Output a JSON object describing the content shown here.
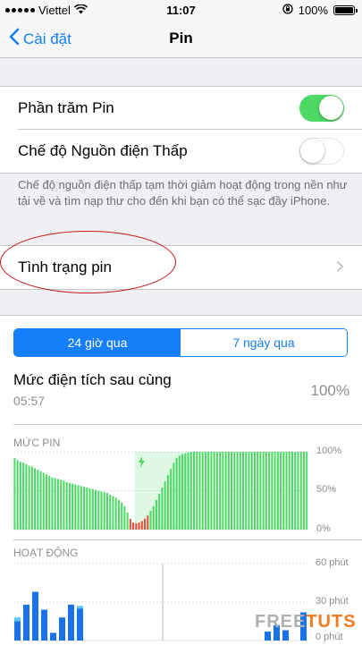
{
  "status_bar": {
    "carrier": "Viettel",
    "time": "11:07",
    "battery": "100%"
  },
  "nav": {
    "back_label": "Cài đặt",
    "title": "Pin"
  },
  "settings": {
    "battery_percentage": {
      "label": "Phần trăm Pin",
      "on": true
    },
    "low_power_mode": {
      "label": "Chế độ Nguồn điện Thấp",
      "on": false
    },
    "footnote": "Chế độ nguồn điện thấp tạm thời giảm hoạt động trong nền như tải về và tìm nạp thư cho đến khi bạn có thể sạc đầy iPhone.",
    "battery_health": {
      "label": "Tình trạng pin"
    }
  },
  "segments": {
    "option1": "24 giờ qua",
    "option2": "7 ngày qua",
    "selected": "option1"
  },
  "last_charge": {
    "title": "Mức điện tích sau cùng",
    "time": "05:57",
    "percent": "100%"
  },
  "colors": {
    "accent": "#147efb",
    "green": "#4cd964",
    "red": "#e74c3c",
    "activity_dark": "#1a73e8",
    "activity_light": "#5ac8fa"
  },
  "chart_data": [
    {
      "type": "bar",
      "title": "MỨC PIN",
      "y_ticks": [
        "100%",
        "50%",
        "0%"
      ],
      "ylim": [
        0,
        100
      ],
      "charging_icon": "lightning-icon",
      "values": [
        92,
        89,
        87,
        86,
        84,
        82,
        81,
        79,
        77,
        75,
        73,
        71,
        69,
        67,
        66,
        65,
        64,
        63,
        61,
        60,
        59,
        58,
        57,
        56,
        55,
        54,
        53,
        52,
        51,
        50,
        49,
        48,
        47,
        45,
        43,
        41,
        38,
        35,
        30,
        22,
        14,
        9,
        8,
        9,
        11,
        14,
        18,
        24,
        30,
        38,
        46,
        54,
        62,
        70,
        78,
        86,
        92,
        95,
        97,
        98,
        99,
        100,
        100,
        100,
        100,
        100,
        100,
        100,
        100,
        100,
        100,
        100,
        100,
        100,
        100,
        100,
        100,
        100,
        100,
        100,
        100,
        100,
        100,
        100,
        100,
        100,
        100,
        100,
        100,
        100,
        100,
        100,
        100,
        100,
        100,
        100,
        100,
        100,
        100,
        100,
        100,
        100
      ],
      "charging_start_index": 42
    },
    {
      "type": "bar",
      "title": "HOẠT ĐỘNG",
      "y_ticks": [
        "60 phút",
        "30 phút",
        "0 phút"
      ],
      "ylim": [
        0,
        60
      ],
      "screen_on": [
        15,
        28,
        38,
        24,
        6,
        18,
        28,
        25,
        0,
        0,
        0,
        0,
        0,
        0,
        0,
        0,
        0,
        0,
        0,
        0,
        0,
        0,
        0,
        0,
        0,
        0,
        0,
        0,
        7,
        12,
        8,
        0,
        22
      ],
      "screen_off": [
        3,
        0,
        0,
        0,
        0,
        0,
        0,
        2,
        0,
        0,
        0,
        0,
        0,
        0,
        0,
        0,
        0,
        0,
        0,
        0,
        0,
        0,
        0,
        0,
        0,
        0,
        0,
        0,
        0,
        0,
        0,
        0,
        0
      ]
    }
  ],
  "watermark": {
    "text": "FREETUTS"
  }
}
